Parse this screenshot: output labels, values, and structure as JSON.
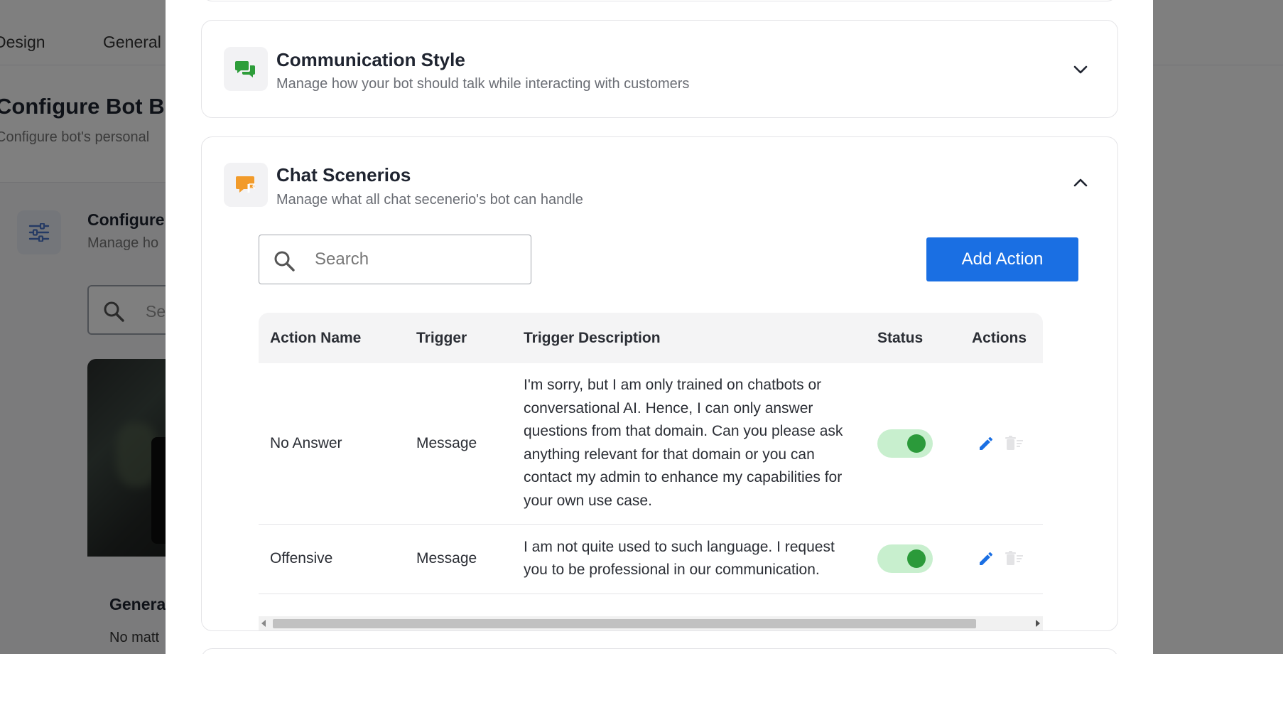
{
  "background": {
    "tabs": [
      "Design",
      "General"
    ],
    "title": "Configure Bot B",
    "subtitle": "Configure bot's personal",
    "section_title": "Configure",
    "section_sub": "Manage ho",
    "search_placeholder": "Se",
    "general_title": "Genera",
    "general_text": "No matt"
  },
  "modal": {
    "communication": {
      "title": "Communication Style",
      "subtitle": "Manage how your bot should talk while interacting with customers",
      "icon": "chat-bubbles-icon",
      "icon_color": "#2e9d3a",
      "expanded": false
    },
    "scenarios": {
      "title": "Chat Scenerios",
      "subtitle": "Manage what all chat secenerio's bot can handle",
      "icon": "flag-message-icon",
      "icon_color": "#f29b2a",
      "expanded": true,
      "search_placeholder": "Search",
      "add_label": "Add Action",
      "accent": "#1a6fe3",
      "columns": [
        "Action Name",
        "Trigger",
        "Trigger Description",
        "Status",
        "Actions"
      ],
      "rows": [
        {
          "name": "No Answer",
          "trigger": "Message",
          "description": "I'm sorry, but I am only trained on chatbots or conversational AI. Hence, I can only answer questions from that domain. Can you please ask anything relevant for that domain or you can contact my admin to enhance my capabilities for your own use case.",
          "status": true
        },
        {
          "name": "Offensive",
          "trigger": "Message",
          "description": "I am not quite used to such language. I request you to be professional in our communication.",
          "status": true
        }
      ]
    }
  }
}
